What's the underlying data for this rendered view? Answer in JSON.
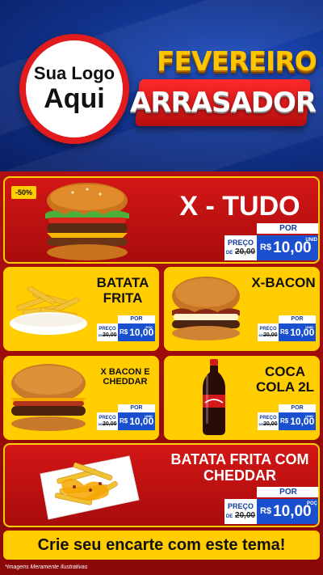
{
  "header": {
    "logo_line1": "Sua Logo",
    "logo_line2": "Aqui",
    "title_top": "FEVEREIRO",
    "title_bottom": "ARRASADOR"
  },
  "products": [
    {
      "name": "X - TUDO",
      "badge": "-50%",
      "por": "POR",
      "price_label": "PREÇO",
      "de": "DE",
      "old_price": "20,00",
      "currency": "R$",
      "price": "10,00",
      "unit": "UNID",
      "image_icon": "burger-icon"
    },
    {
      "name": "BATATA FRITA",
      "por": "POR",
      "price_label": "PREÇO",
      "de": "DE",
      "old_price": "20,00",
      "currency": "R$",
      "price": "10,00",
      "unit": "POÇ",
      "image_icon": "fries-icon"
    },
    {
      "name": "X-BACON",
      "por": "POR",
      "price_label": "PREÇO",
      "de": "DE",
      "old_price": "20,00",
      "currency": "R$",
      "price": "10,00",
      "unit": "UNID",
      "image_icon": "burger-icon"
    },
    {
      "name": "X BACON E CHEDDAR",
      "por": "POR",
      "price_label": "PREÇO",
      "de": "DE",
      "old_price": "20,00",
      "currency": "R$",
      "price": "10,00",
      "unit": "UNID",
      "image_icon": "burger-icon"
    },
    {
      "name": "COCA COLA 2L",
      "por": "POR",
      "price_label": "PREÇO",
      "de": "DE",
      "old_price": "20,00",
      "currency": "R$",
      "price": "10,00",
      "unit": "UNID",
      "image_icon": "soda-bottle-icon"
    },
    {
      "name": "BATATA FRITA COM CHEDDAR",
      "por": "POR",
      "price_label": "PREÇO",
      "de": "DE",
      "old_price": "20,00",
      "currency": "R$",
      "price": "10,00",
      "unit": "POÇ",
      "image_icon": "cheddar-fries-icon"
    }
  ],
  "banner": "Crie seu encarte com este tema!",
  "footnote": "*Imagens Meramente Ilustrativas",
  "colors": {
    "red": "#d41616",
    "yellow": "#ffcd00",
    "blue": "#1a4fd0",
    "navy": "#0a1f63"
  }
}
